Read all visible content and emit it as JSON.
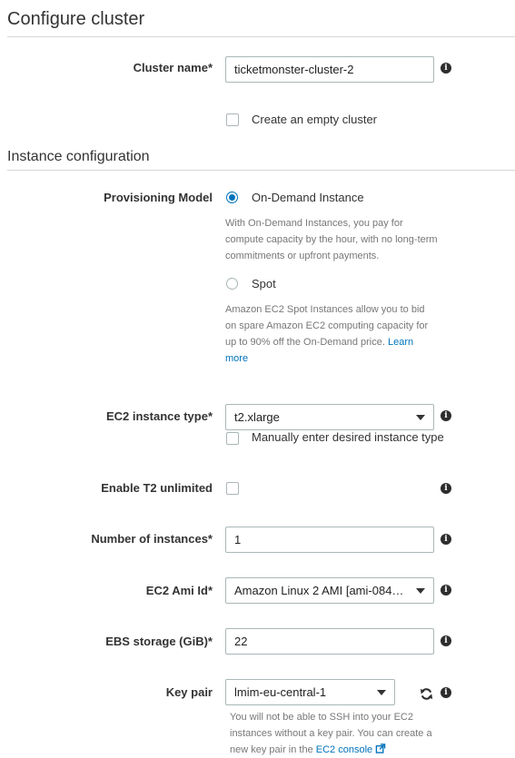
{
  "section_title": "Configure cluster",
  "cluster_name": {
    "label": "Cluster name*",
    "value": "ticketmonster-cluster-2",
    "info_icon": "info-icon"
  },
  "empty_cluster": {
    "label": "Create an empty cluster",
    "checked": false
  },
  "instance_section_title": "Instance configuration",
  "provisioning": {
    "label": "Provisioning Model",
    "on_demand": {
      "label": "On-Demand Instance",
      "selected": true,
      "help_1": "With On-Demand Instances, you pay for",
      "help_2": "compute capacity by the hour, with no long-term",
      "help_3": "commitments or upfront payments."
    },
    "spot": {
      "label": "Spot",
      "selected": false,
      "help_1": "Amazon EC2 Spot Instances allow you to bid",
      "help_2": "on spare Amazon EC2 computing capacity for",
      "help_3": "up to 90% off the On-Demand price.",
      "learn_1": "Learn",
      "learn_2": "more"
    }
  },
  "instance_type": {
    "label": "EC2 instance type*",
    "value": "t2.xlarge",
    "manual_label": "Manually enter desired instance type"
  },
  "t2_unlimited": {
    "label": "Enable T2 unlimited",
    "checked": false
  },
  "num_instances": {
    "label": "Number of instances*",
    "value": "1"
  },
  "ami": {
    "label": "EC2 Ami Id*",
    "value": "Amazon Linux 2 AMI [ami-084a..."
  },
  "ebs": {
    "label": "EBS storage (GiB)*",
    "value": "22"
  },
  "key_pair": {
    "label": "Key pair",
    "value": "lmim-eu-central-1",
    "help_1": "You will not be able to SSH into your EC2",
    "help_2": "instances without a key pair. You can create a",
    "help_3": "new key pair in the",
    "console_link": "EC2 console"
  },
  "colors": {
    "accent": "#0073bb",
    "border": "#aab7b8"
  }
}
